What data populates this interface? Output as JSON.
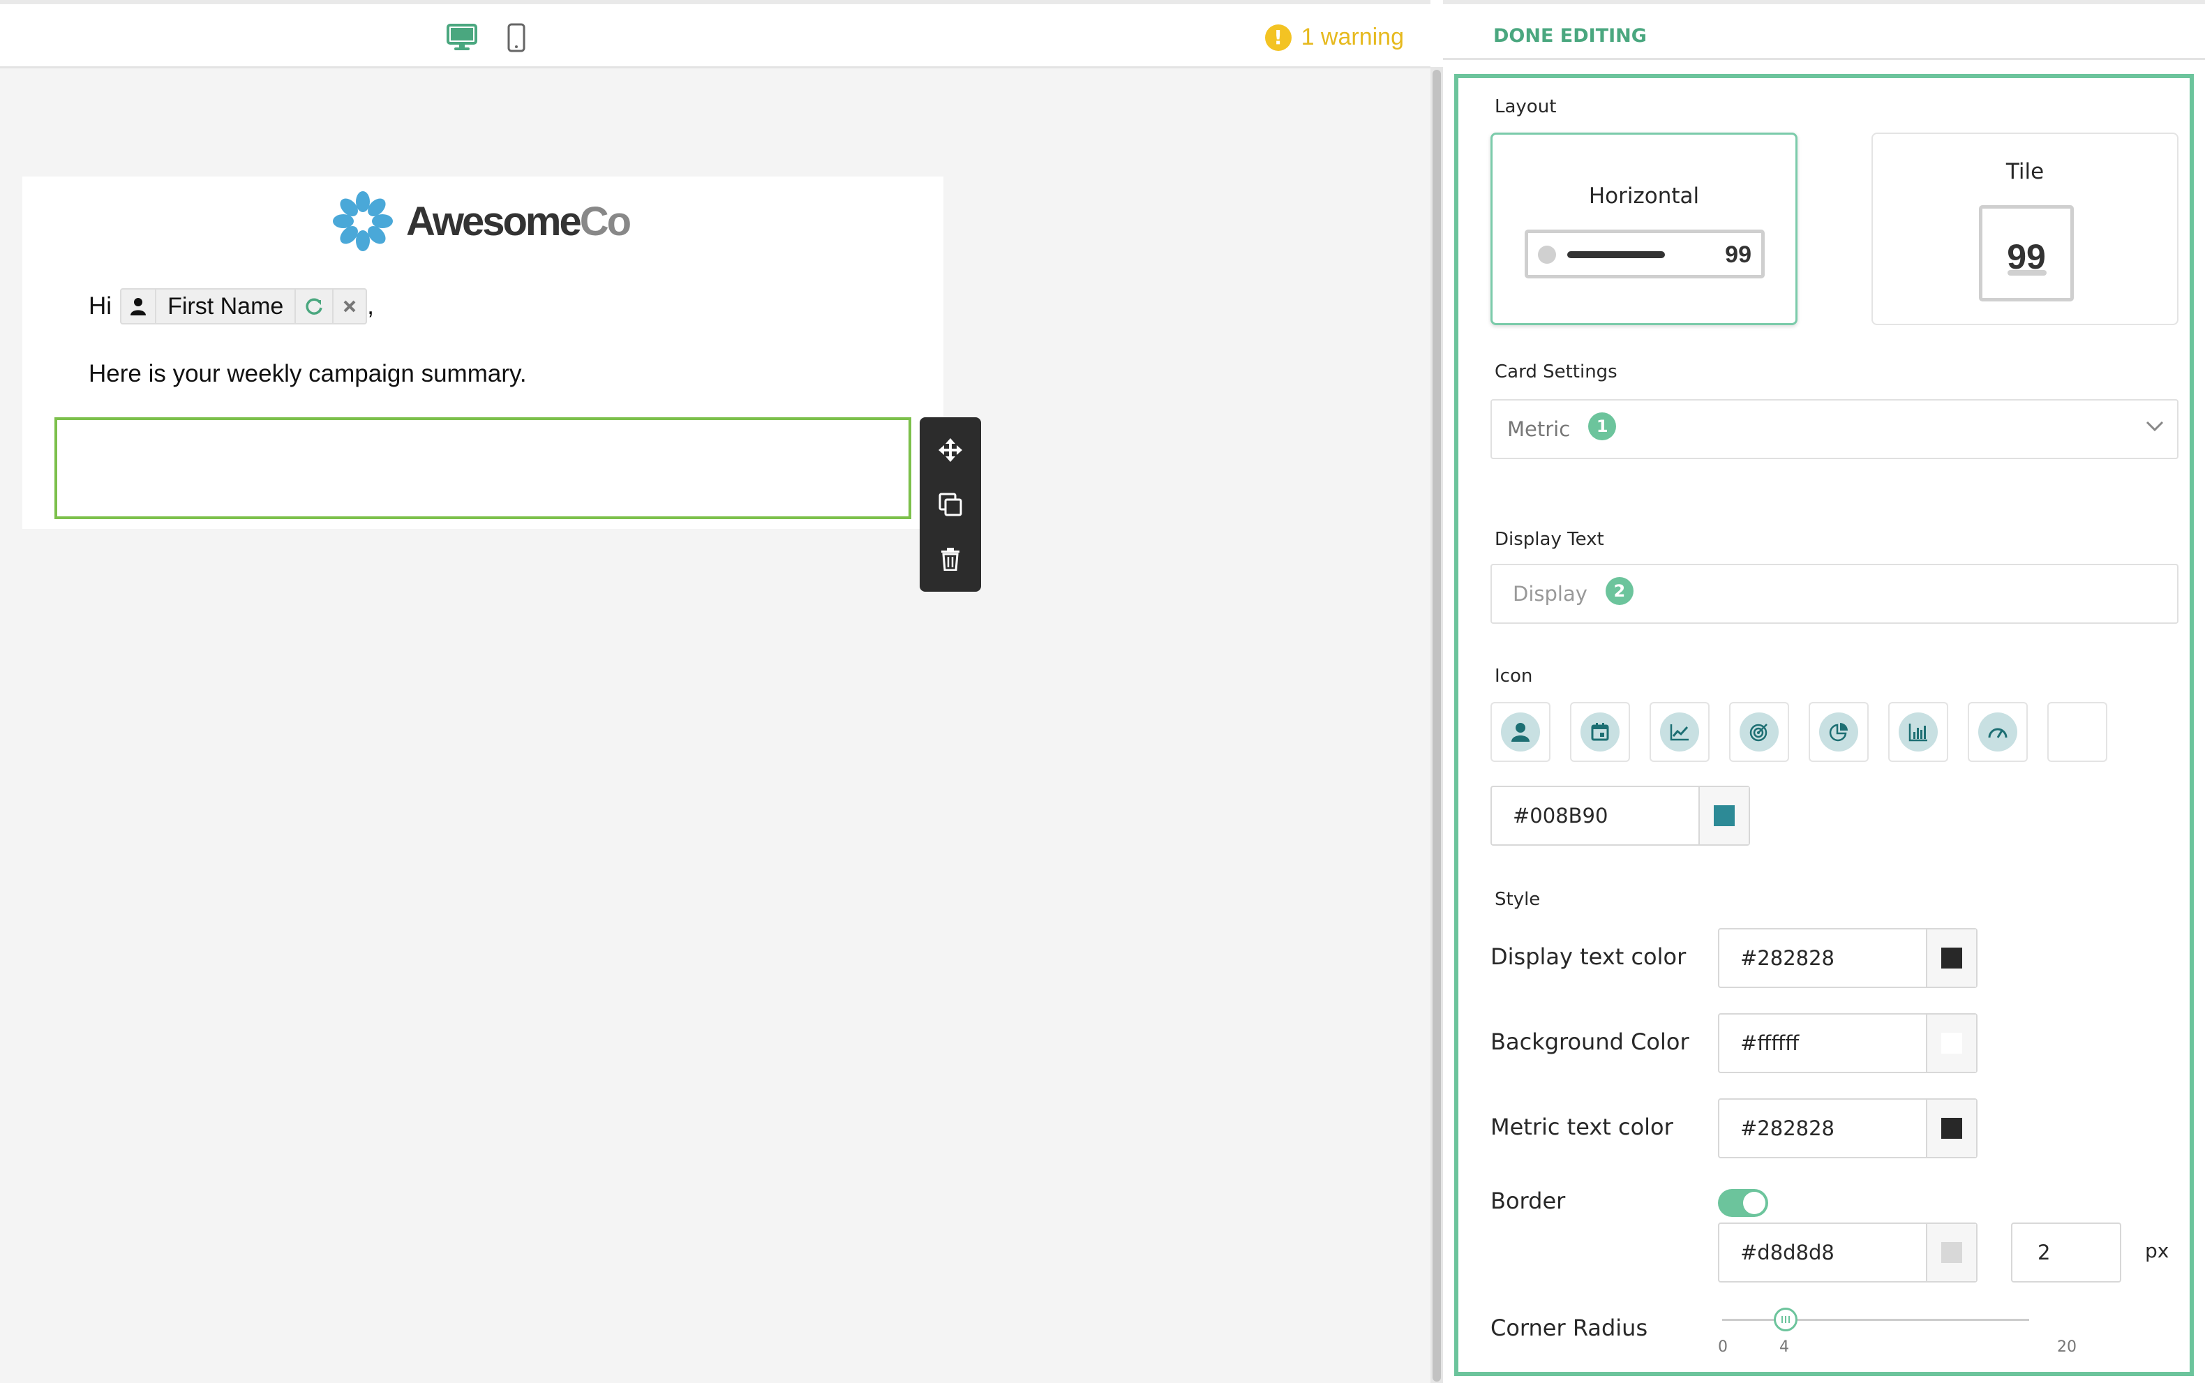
{
  "toolbar": {
    "warning_text": "1 warning",
    "warning_icon": "!",
    "device_modes": [
      "desktop-icon",
      "mobile-icon"
    ]
  },
  "email": {
    "logo": {
      "brand_a": "Awesome",
      "brand_b": "Co"
    },
    "greeting_prefix": "Hi",
    "merge_tag_label": "First Name",
    "greeting_suffix": ",",
    "summary_text": "Here is your weekly campaign summary."
  },
  "panel": {
    "done_label": "DONE EDITING",
    "layout": {
      "title": "Layout",
      "options": [
        {
          "label": "Horizontal",
          "preview_value": "99",
          "selected": true
        },
        {
          "label": "Tile",
          "preview_value": "99",
          "selected": false
        }
      ]
    },
    "card_settings": {
      "title": "Card Settings",
      "value": "Metric",
      "badge": "1"
    },
    "display_text": {
      "title": "Display Text",
      "placeholder": "Display",
      "badge": "2"
    },
    "icon": {
      "title": "Icon",
      "options": [
        "person-icon",
        "calendar-icon",
        "line-chart-icon",
        "target-icon",
        "pie-chart-icon",
        "bar-chart-icon",
        "gauge-icon",
        "none"
      ],
      "color": "#008B90"
    },
    "style": {
      "title": "Style",
      "display_text_color": {
        "label": "Display text color",
        "value": "#282828"
      },
      "background_color": {
        "label": "Background Color",
        "value": "#ffffff"
      },
      "metric_text_color": {
        "label": "Metric text color",
        "value": "#282828"
      },
      "border": {
        "label": "Border",
        "enabled": true,
        "color": "#d8d8d8",
        "width": "2",
        "unit": "px"
      },
      "corner_radius": {
        "label": "Corner Radius",
        "value": 4,
        "min": 0,
        "max": 20,
        "ticks": [
          "0",
          "4",
          "20"
        ]
      }
    }
  },
  "colors": {
    "accent": "#6cc49c",
    "warning": "#e6b91e",
    "selection_border": "#7cc04b",
    "toolbar_bg": "#2c2c2c"
  }
}
